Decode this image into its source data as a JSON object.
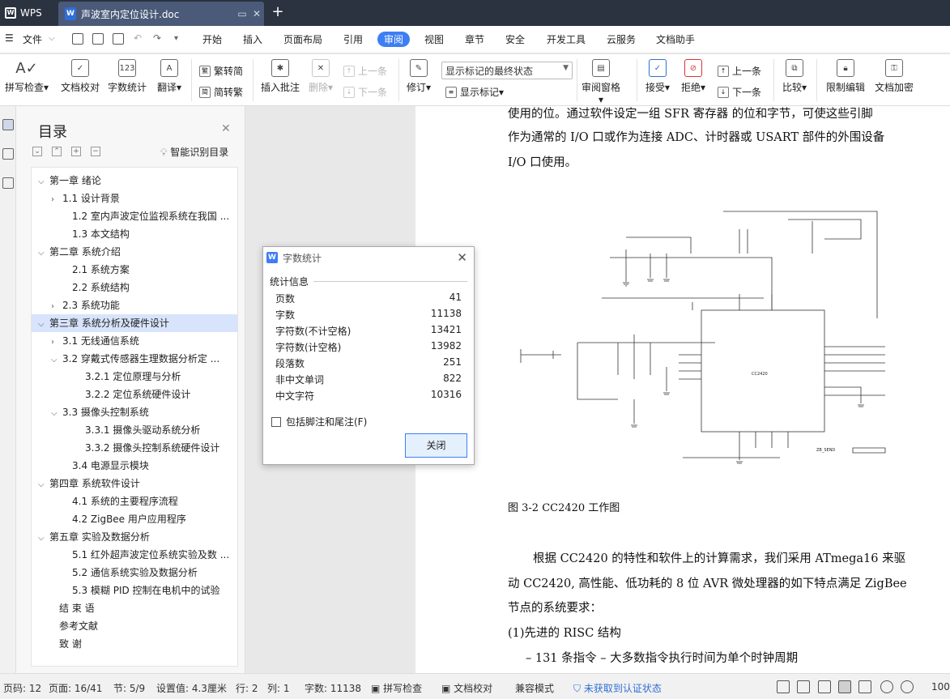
{
  "app": {
    "brand": "WPS",
    "doc_tab": "声波室内定位设计.doc",
    "doc_icon": "W",
    "plus": "+"
  },
  "menu": {
    "file": "文件",
    "tabs": [
      "开始",
      "插入",
      "页面布局",
      "引用",
      "审阅",
      "视图",
      "章节",
      "安全",
      "开发工具",
      "云服务",
      "文档助手"
    ],
    "active_tab": "审阅"
  },
  "ribbon": {
    "spell": "拼写检查",
    "proofread": "文档校对",
    "wordcount": "字数统计",
    "translate": "翻译",
    "trad": "繁转简",
    "simp": "简转繁",
    "insert_comment": "插入批注",
    "delete": "删除",
    "prev_comment": "上一条",
    "next_comment": "下一条",
    "revise": "修订",
    "markup_state": "显示标记的最终状态",
    "show_markup": "显示标记",
    "review_pane": "审阅窗格",
    "accept": "接受",
    "reject": "拒绝",
    "prev": "上一条",
    "next": "下一条",
    "compare": "比较",
    "restrict": "限制编辑",
    "encrypt": "文档加密"
  },
  "toc": {
    "title": "目录",
    "smart": "智能识别目录",
    "items": [
      {
        "label": "第一章  绪论",
        "caret": "v"
      },
      {
        "label": "1.1  设计背景",
        "caret": ">"
      },
      {
        "label": "1.2  室内声波定位监视系统在我国 ...",
        "caret": ""
      },
      {
        "label": "1.3  本文结构",
        "caret": ""
      },
      {
        "label": "第二章  系统介绍",
        "caret": "v"
      },
      {
        "label": "2.1  系统方案",
        "caret": ""
      },
      {
        "label": "2.2  系统结构",
        "caret": ""
      },
      {
        "label": "2.3  系统功能",
        "caret": ">"
      },
      {
        "label": "第三章  系统分析及硬件设计",
        "caret": "v"
      },
      {
        "label": "3.1  无线通信系统",
        "caret": ">"
      },
      {
        "label": "3.2  穿戴式传感器生理数据分析定 ...",
        "caret": "v"
      },
      {
        "label": "3.2.1  定位原理与分析",
        "caret": ""
      },
      {
        "label": "3.2.2  定位系统硬件设计",
        "caret": ""
      },
      {
        "label": "3.3  摄像头控制系统",
        "caret": "v"
      },
      {
        "label": "3.3.1  摄像头驱动系统分析",
        "caret": ""
      },
      {
        "label": "3.3.2  摄像头控制系统硬件设计",
        "caret": ""
      },
      {
        "label": "3.4  电源显示模块",
        "caret": ""
      },
      {
        "label": "第四章  系统软件设计",
        "caret": "v"
      },
      {
        "label": "4.1    系统的主要程序流程",
        "caret": ""
      },
      {
        "label": "4.2    ZigBee 用户应用程序",
        "caret": ""
      },
      {
        "label": "第五章  实验及数据分析",
        "caret": "v"
      },
      {
        "label": "5.1  红外超声波定位系统实验及数 ...",
        "caret": ""
      },
      {
        "label": "5.2  通信系统实验及数据分析",
        "caret": ""
      },
      {
        "label": "5.3  模糊 PID 控制在电机中的试验",
        "caret": ""
      },
      {
        "label": "结  束  语",
        "caret": ""
      },
      {
        "label": "参考文献",
        "caret": ""
      },
      {
        "label": "致    谢",
        "caret": ""
      }
    ]
  },
  "document": {
    "line1": "使用的位。通过软件设定一组 SFR 寄存器 的位和字节，可使这些引脚",
    "line2": "作为通常的 I/O  口或作为连接 ADC、计时器或 USART 部件的外围设备",
    "line3": "I/O  口使用。",
    "caption": "图 3-2 CC2420 工作图",
    "para1": "根据 CC2420 的特性和软件上的计算需求，我们采用 ATmega16 来驱",
    "para2": "动 CC2420, 高性能、低功耗的 8 位 AVR 微处理器的如下特点满足 ZigBee",
    "para3": "节点的系统要求：",
    "para4": "(1)先进的 RISC  结构",
    "para5": "– 131  条指令  – 大多数指令执行时间为单个时钟周期",
    "chip_label": "CC2420",
    "port_label": "ZB_SEND"
  },
  "dialog": {
    "title": "字数统计",
    "section": "统计信息",
    "rows": [
      {
        "label": "页数",
        "value": "41"
      },
      {
        "label": "字数",
        "value": "11138"
      },
      {
        "label": "字符数(不计空格)",
        "value": "13421"
      },
      {
        "label": "字符数(计空格)",
        "value": "13982"
      },
      {
        "label": "段落数",
        "value": "251"
      },
      {
        "label": "非中文单词",
        "value": "822"
      },
      {
        "label": "中文字符",
        "value": "10316"
      }
    ],
    "checkbox": "包括脚注和尾注(F)",
    "close": "关闭"
  },
  "status": {
    "page": "页码: 12",
    "pages": "页面: 16/41",
    "section": "节: 5/9",
    "setting": "设置值: 4.3厘米",
    "row": "行: 2",
    "col": "列: 1",
    "words": "字数: 11138",
    "spell": "拼写检查",
    "proof": "文档校对",
    "compat": "兼容模式",
    "cert": "未获取到认证状态",
    "zoom": "100"
  },
  "colors": {
    "accent": "#3d7ef4",
    "tabbar": "#2b3240",
    "selection": "#d7e4fb"
  }
}
